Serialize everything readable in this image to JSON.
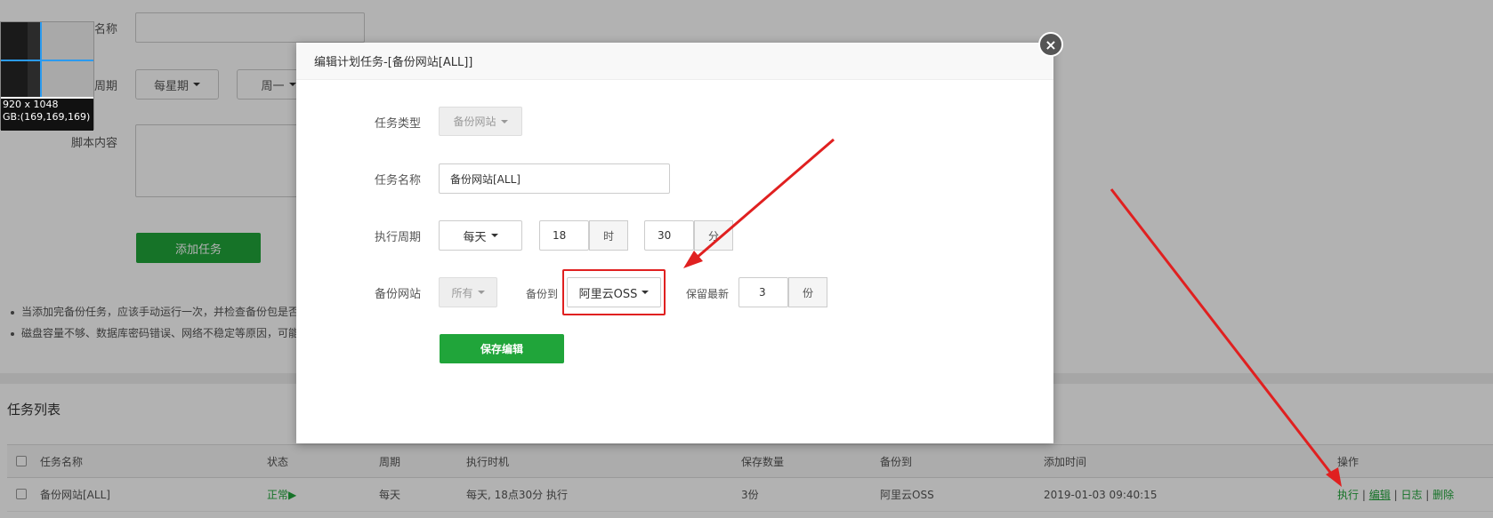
{
  "background_form": {
    "name_label": "任务名称",
    "period_label": "执行周期",
    "period_select": "每星期",
    "weekday_select": "周一",
    "script_label": "脚本内容",
    "add_button": "添加任务"
  },
  "preview": {
    "size": "920 x 1048",
    "rgb": "GB:(169,169,169)"
  },
  "tips": [
    "当添加完备份任务，应该手动运行一次，并检查备份包是否",
    "磁盘容量不够、数据库密码错误、网络不稳定等原因，可能"
  ],
  "task_list": {
    "title": "任务列表",
    "columns": [
      "任务名称",
      "状态",
      "周期",
      "执行时机",
      "保存数量",
      "备份到",
      "添加时间",
      "操作"
    ],
    "rows": [
      {
        "name": "备份网站[ALL]",
        "status": "正常▶",
        "period": "每天",
        "timing": "每天, 18点30分 执行",
        "keep": "3份",
        "dest": "阿里云OSS",
        "added": "2019-01-03 09:40:15",
        "actions": [
          "执行",
          "编辑",
          "日志",
          "删除"
        ]
      }
    ],
    "sep": "|"
  },
  "modal": {
    "title": "编辑计划任务-[备份网站[ALL]]",
    "close_icon": "×",
    "type_label": "任务类型",
    "type_value": "备份网站",
    "name_label": "任务名称",
    "name_value": "备份网站[ALL]",
    "period_label": "执行周期",
    "period_value": "每天",
    "hour_value": "18",
    "hour_unit": "时",
    "minute_value": "30",
    "minute_unit": "分",
    "site_label": "备份网站",
    "site_value": "所有",
    "dest_label": "备份到",
    "dest_value": "阿里云OSS",
    "keep_label": "保留最新",
    "keep_value": "3",
    "keep_unit": "份",
    "save_button": "保存编辑"
  },
  "colors": {
    "accent": "#20a53a",
    "highlight": "#e02020"
  }
}
